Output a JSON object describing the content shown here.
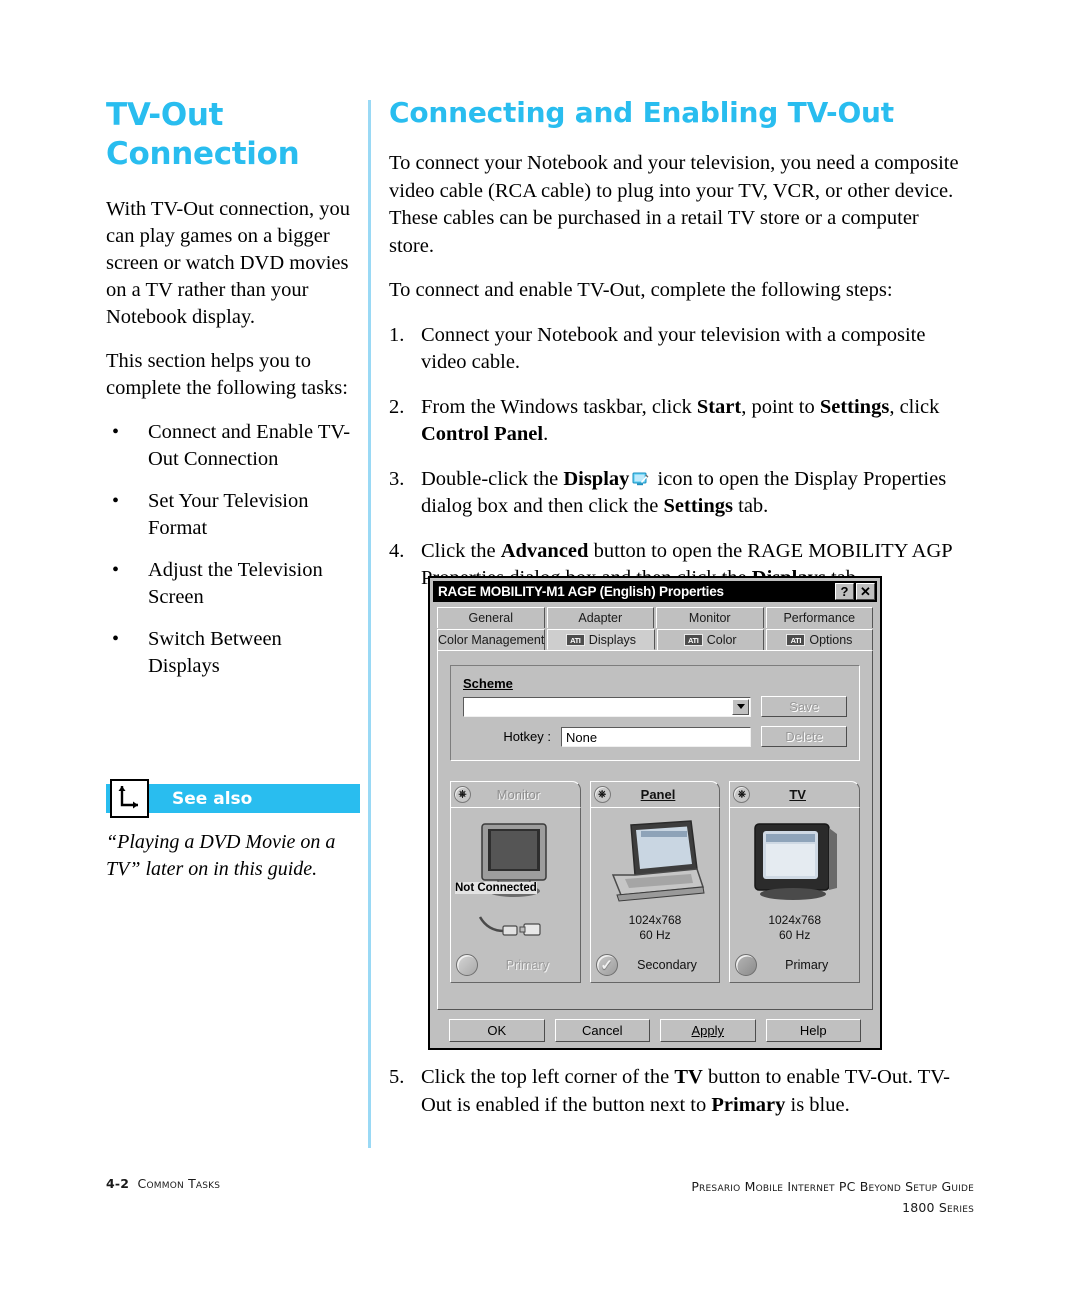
{
  "sidebar": {
    "title": "TV-Out Connection",
    "title_line1": "TV-Out",
    "title_line2": "Connection",
    "paragraph1": "With TV-Out connection, you can play games on a bigger screen or watch DVD movies on a TV rather than your Notebook display.",
    "paragraph2": "This section helps you to complete the following tasks:",
    "bullets": [
      {
        "dot": "•",
        "label": "Connect and Enable TV-Out Connection"
      },
      {
        "dot": "•",
        "label": "Set Your Television Format"
      },
      {
        "dot": "•",
        "label": "Adjust the Television Screen"
      },
      {
        "dot": "•",
        "label": "Switch Between Displays"
      }
    ],
    "see_also": {
      "label": "See also",
      "icon": "corner-arrow-icon",
      "text": "“Playing a DVD Movie on a TV” later on in this guide."
    }
  },
  "main": {
    "title": "Connecting and Enabling TV-Out",
    "paragraph1": "To connect your Notebook and your television, you need a composite video cable (RCA cable) to plug into your TV, VCR, or other device. These cables can be purchased in a retail TV store or a computer store.",
    "paragraph2": "To connect and enable TV-Out, complete the following steps:",
    "steps": [
      {
        "num": "1.",
        "text": "Connect your Notebook and your television with a composite video cable."
      },
      {
        "num": "2.",
        "text": "From the Windows taskbar, click Start, point to Settings, click Control Panel."
      },
      {
        "num": "3.",
        "text": "Double-click the Display icon to open the Display Properties dialog box and then click the Settings tab."
      },
      {
        "num": "4.",
        "text": "Click the Advanced button to open the RAGE MOBILITY AGP Properties dialog box and then click the Displays tab."
      },
      {
        "num": "5.",
        "text": "Click the top left corner of the TV button to enable TV-Out. TV-Out is enabled if the button next to Primary is blue."
      }
    ],
    "step2_parts": {
      "a": "From the Windows taskbar, click ",
      "b": "Start",
      "c": ", point to ",
      "d": "Settings",
      "e": ", click ",
      "f": "Control Panel",
      "g": "."
    },
    "step3_parts": {
      "a": "Double-click the ",
      "b": "Display",
      "c": " icon to open the Display Properties dialog box and then click the ",
      "d": "Settings",
      "e": " tab."
    },
    "step4_parts": {
      "a": "Click the ",
      "b": "Advanced",
      "c": " button to open the RAGE MOBILITY AGP Properties dialog box and then click the ",
      "d": "Displays",
      "e": " tab."
    },
    "step5_parts": {
      "a": "Click the top left corner of the ",
      "b": "TV",
      "c": " button to enable TV-Out. TV-Out is enabled if the button next to ",
      "d": "Primary",
      "e": " is blue."
    }
  },
  "dialog": {
    "title": "RAGE MOBILITY-M1 AGP (English) Properties",
    "help_button": "?",
    "close_button": "✕",
    "tabs_row1": [
      "General",
      "Adapter",
      "Monitor",
      "Performance"
    ],
    "tabs_row2": [
      {
        "label": "Color Management",
        "badge": ""
      },
      {
        "label": "Displays",
        "badge": "ATI",
        "active": true
      },
      {
        "label": "Color",
        "badge": "ATI"
      },
      {
        "label": "Options",
        "badge": "ATI"
      }
    ],
    "scheme": {
      "group_label": "Scheme",
      "combo_value": "",
      "hotkey_label": "Hotkey :",
      "hotkey_value": "None",
      "save_button": "Save",
      "delete_button": "Delete"
    },
    "displays": [
      {
        "name": "Monitor",
        "power": "⏻",
        "status": "Not Connected",
        "resolution": "",
        "refresh": "",
        "role": "Primary",
        "enabled": false,
        "checked": false
      },
      {
        "name": "Panel",
        "power": "⏻",
        "status": "",
        "resolution": "1024x768",
        "refresh": "60 Hz",
        "role": "Secondary",
        "enabled": true,
        "checked": true
      },
      {
        "name": "TV",
        "power": "⏻",
        "status": "",
        "resolution": "1024x768",
        "refresh": "60 Hz",
        "role": "Primary",
        "enabled": true,
        "checked": false
      }
    ],
    "buttons": [
      "OK",
      "Cancel",
      "Apply",
      "Help"
    ]
  },
  "footer": {
    "page_number": "4-2",
    "section": "Common Tasks",
    "guide_title": "Presario Mobile Internet PC Beyond Setup Guide",
    "series": "1800 Series"
  },
  "colors": {
    "accent_cyan": "#29bdef",
    "divider_blue": "#9ad9f5",
    "dialog_gray": "#c0c0c0"
  }
}
